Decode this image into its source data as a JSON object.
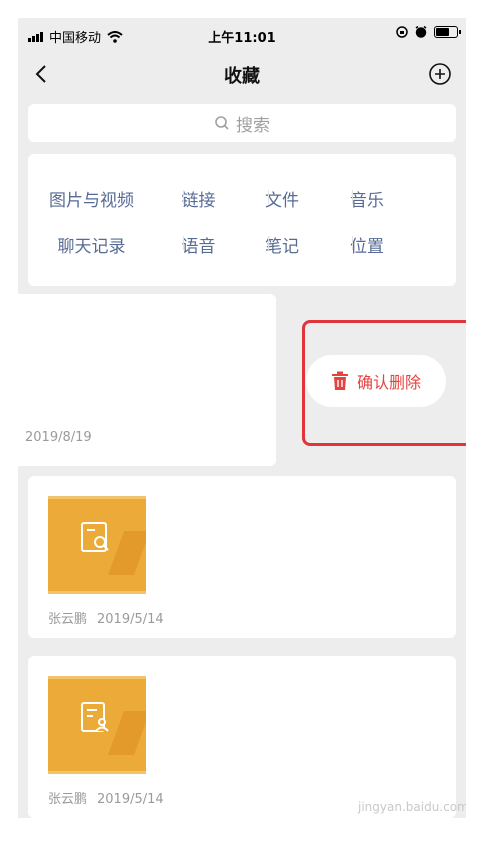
{
  "status_bar": {
    "carrier": "中国移动",
    "time": "上午11:01"
  },
  "nav": {
    "title": "收藏"
  },
  "search": {
    "placeholder": "搜索"
  },
  "categories": {
    "row1": [
      "图片与视频",
      "链接",
      "文件",
      "音乐"
    ],
    "row2": [
      "聊天记录",
      "语音",
      "笔记",
      "位置"
    ]
  },
  "swiped_item": {
    "date": "2019/8/19",
    "delete_label": "确认删除"
  },
  "favorites": [
    {
      "author": "张云鹏",
      "date": "2019/5/14",
      "icon": "search-doc-icon"
    },
    {
      "author": "张云鹏",
      "date": "2019/5/14",
      "icon": "contact-doc-icon"
    }
  ],
  "watermark": "jingyan.baidu.com",
  "colors": {
    "link": "#576b95",
    "danger": "#e64340",
    "highlight": "#e0353a",
    "thumb": "#ecaa38"
  }
}
